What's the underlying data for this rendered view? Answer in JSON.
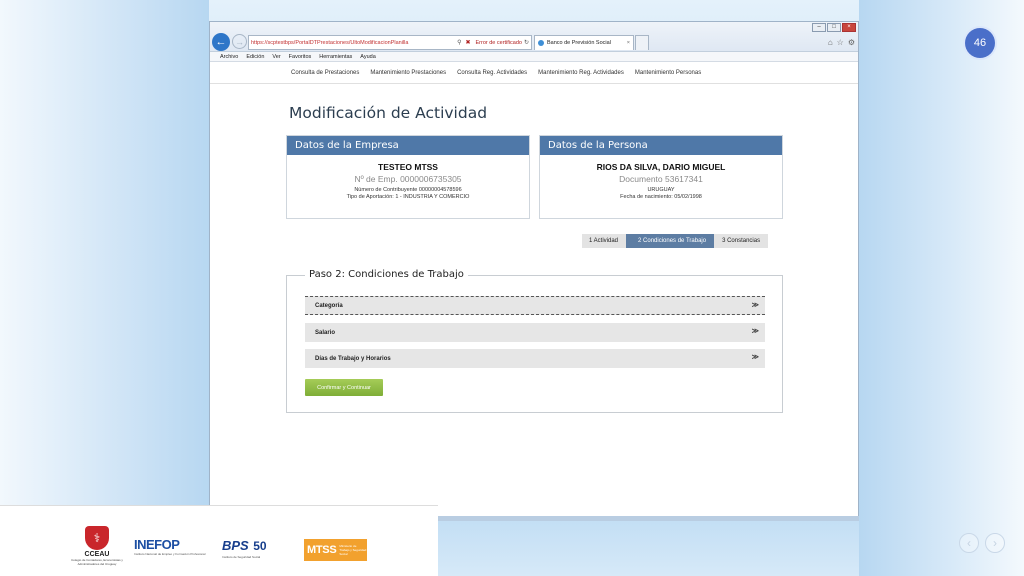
{
  "slide": {
    "page_number": "46"
  },
  "browser": {
    "url": "https://scptestbps/PortalDTPrestaciones/UltoModificacionPlanilla",
    "cert_error": "Error de certificado",
    "tab_title": "Banco de Previsión Social",
    "menu": [
      "Archivo",
      "Edición",
      "Ver",
      "Favoritos",
      "Herramientas",
      "Ayuda"
    ]
  },
  "site_nav": [
    "Consulta de Prestaciones",
    "Mantenimiento Prestaciones",
    "Consulta Reg. Actividades",
    "Mantenimiento Reg. Actividades",
    "Mantenimiento Personas"
  ],
  "page": {
    "title": "Modificación de Actividad"
  },
  "empresa": {
    "header": "Datos de la Empresa",
    "name": "TESTEO MTSS",
    "emp_number": "Nº de Emp. 0000006735305",
    "contribuyente": "Número de Contribuyente 00000004578596",
    "aportacion": "Tipo de Aportación: 1 - INDUSTRIA Y COMERCIO"
  },
  "persona": {
    "header": "Datos de la Persona",
    "name": "RIOS DA SILVA, DARIO MIGUEL",
    "documento": "Documento 53617341",
    "pais": "URUGUAY",
    "nacimiento": "Fecha de nacimiento: 05/02/1998"
  },
  "steps": [
    "1 Actividad",
    "2 Condiciones de Trabajo",
    "3 Constancias"
  ],
  "form": {
    "legend": "Paso 2: Condiciones de Trabajo",
    "sections": [
      "Categoría",
      "Salario",
      "Días de Trabajo y Horarios"
    ],
    "confirm_label": "Confirmar y Continuar"
  },
  "footer_logos": {
    "ceeau": "CCEAU",
    "ceeau_sub": "Colegio de Contadores, Economistas y Administradores del Uruguay",
    "inefop": "INEFOP",
    "inefop_sub": "Instituto Nacional de Empleo y Formación Profesional",
    "bps": "BPS",
    "bps_50": "50",
    "bps_sub": "Instituto de Seguridad Social",
    "mtss": "MTSS",
    "mtss_sub": "Ministerio de Trabajo y Seguridad Social"
  },
  "icons": [
    "back-arrow-icon",
    "forward-arrow-icon",
    "search-icon",
    "lock-icon",
    "refresh-icon",
    "home-icon",
    "star-icon",
    "gear-icon",
    "chevron-double-down-icon",
    "chevron-left-icon",
    "chevron-right-icon"
  ],
  "colors": {
    "panel_header": "#4f78a8",
    "confirm_button": "#8cbc3f",
    "page_badge": "#4a6fc9",
    "step_active": "#5d7da3"
  }
}
